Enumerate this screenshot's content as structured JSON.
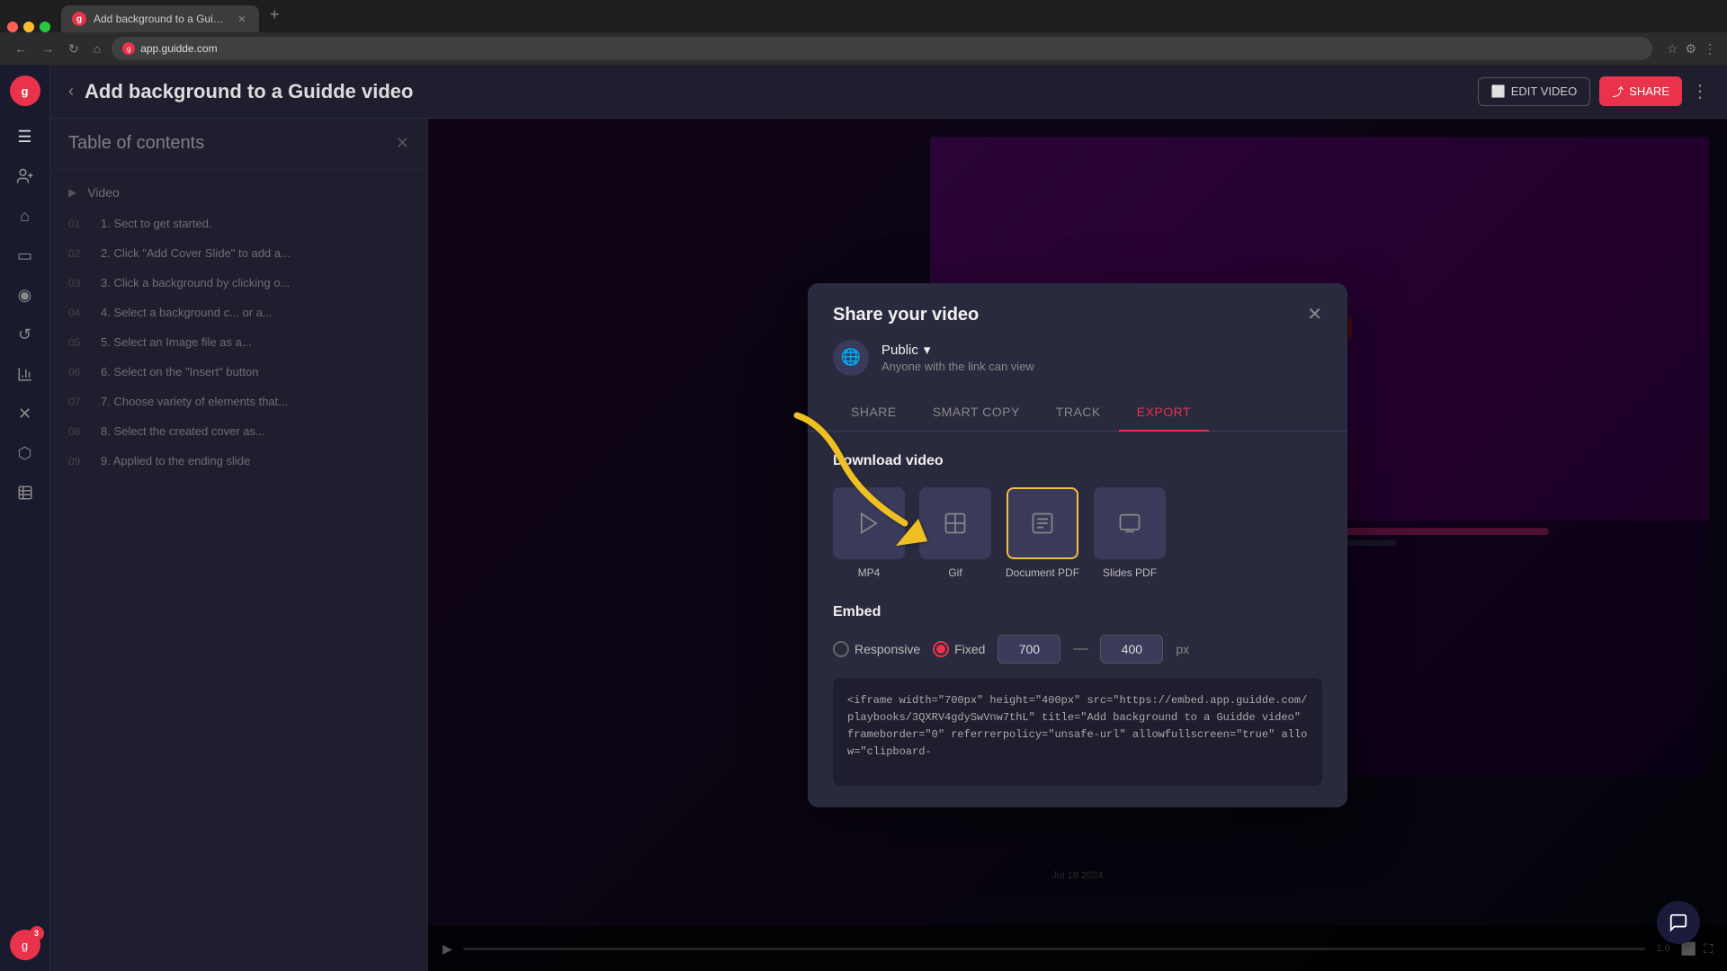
{
  "browser": {
    "tab_title": "Add background to a Guidde video",
    "tab_favicon": "g",
    "url": "app.guidde.com",
    "new_tab_label": "+"
  },
  "header": {
    "title": "Add background to a Guidde video",
    "back_label": "‹",
    "edit_video_label": "EDIT VIDEO",
    "share_label": "SHARE",
    "menu_label": "⋮"
  },
  "toc": {
    "title": "Table of contents",
    "close_label": "✕",
    "section": {
      "label": "Video"
    },
    "items": [
      {
        "num": "01",
        "text": "1. Sect to get started."
      },
      {
        "num": "02",
        "text": "2. Click \"Add Cover Slide\" to add a..."
      },
      {
        "num": "03",
        "text": "3. Click a background by clicking o..."
      },
      {
        "num": "04",
        "text": "4. Select a background c... or a..."
      },
      {
        "num": "05",
        "text": "5. Select an Image file as a..."
      },
      {
        "num": "06",
        "text": "6. Select on the \"Insert\" button"
      },
      {
        "num": "07",
        "text": "7. Choose variety of elements that..."
      },
      {
        "num": "08",
        "text": "8. Select the created cover as..."
      },
      {
        "num": "09",
        "text": "9. Applied to the ending slide"
      }
    ]
  },
  "share_modal": {
    "title": "Share your video",
    "close_label": "✕",
    "visibility": {
      "label": "Public",
      "dropdown_icon": "▾",
      "sub_label": "Anyone with the link can view"
    },
    "tabs": [
      {
        "id": "share",
        "label": "SHARE"
      },
      {
        "id": "smart_copy",
        "label": "SMART COPY"
      },
      {
        "id": "track",
        "label": "TRACK"
      },
      {
        "id": "export",
        "label": "EXPORT",
        "active": true
      }
    ],
    "export": {
      "download_section_title": "Download video",
      "options": [
        {
          "id": "mp4",
          "icon": "▷",
          "label": "MP4",
          "selected": false
        },
        {
          "id": "gif",
          "icon": "⊞",
          "label": "Gif",
          "selected": false
        },
        {
          "id": "document_pdf",
          "icon": "☰",
          "label": "Document PDF",
          "selected": true
        },
        {
          "id": "slides_pdf",
          "icon": "⬜",
          "label": "Slides PDF",
          "selected": false
        }
      ],
      "embed_section_title": "Embed",
      "embed_options": [
        {
          "id": "responsive",
          "label": "Responsive",
          "checked": false
        },
        {
          "id": "fixed",
          "label": "Fixed",
          "checked": true
        }
      ],
      "width_value": "700",
      "height_value": "400",
      "size_unit": "px",
      "embed_code": "<iframe width=\"700px\" height=\"400px\" src=\"https://embed.app.guidde.com/playbooks/3QXRV4gdySwVnw7thL\" title=\"Add background to a Guidde video\" frameborder=\"0\" referrerpolicy=\"unsafe-url\" allowfullscreen=\"true\" allow=\"clipboard-"
    }
  },
  "video_area": {
    "date": "Jul 19 2024"
  },
  "sidebar_icons": [
    {
      "id": "menu",
      "icon": "☰"
    },
    {
      "id": "home",
      "icon": "⌂"
    },
    {
      "id": "video",
      "icon": "▭"
    },
    {
      "id": "chat",
      "icon": "◎"
    },
    {
      "id": "refresh",
      "icon": "↺"
    },
    {
      "id": "analytics",
      "icon": "≡"
    },
    {
      "id": "integration",
      "icon": "✕"
    },
    {
      "id": "puzzle",
      "icon": "⬡"
    },
    {
      "id": "report",
      "icon": "📋"
    }
  ],
  "bottom_user": {
    "badge_count": "3"
  }
}
